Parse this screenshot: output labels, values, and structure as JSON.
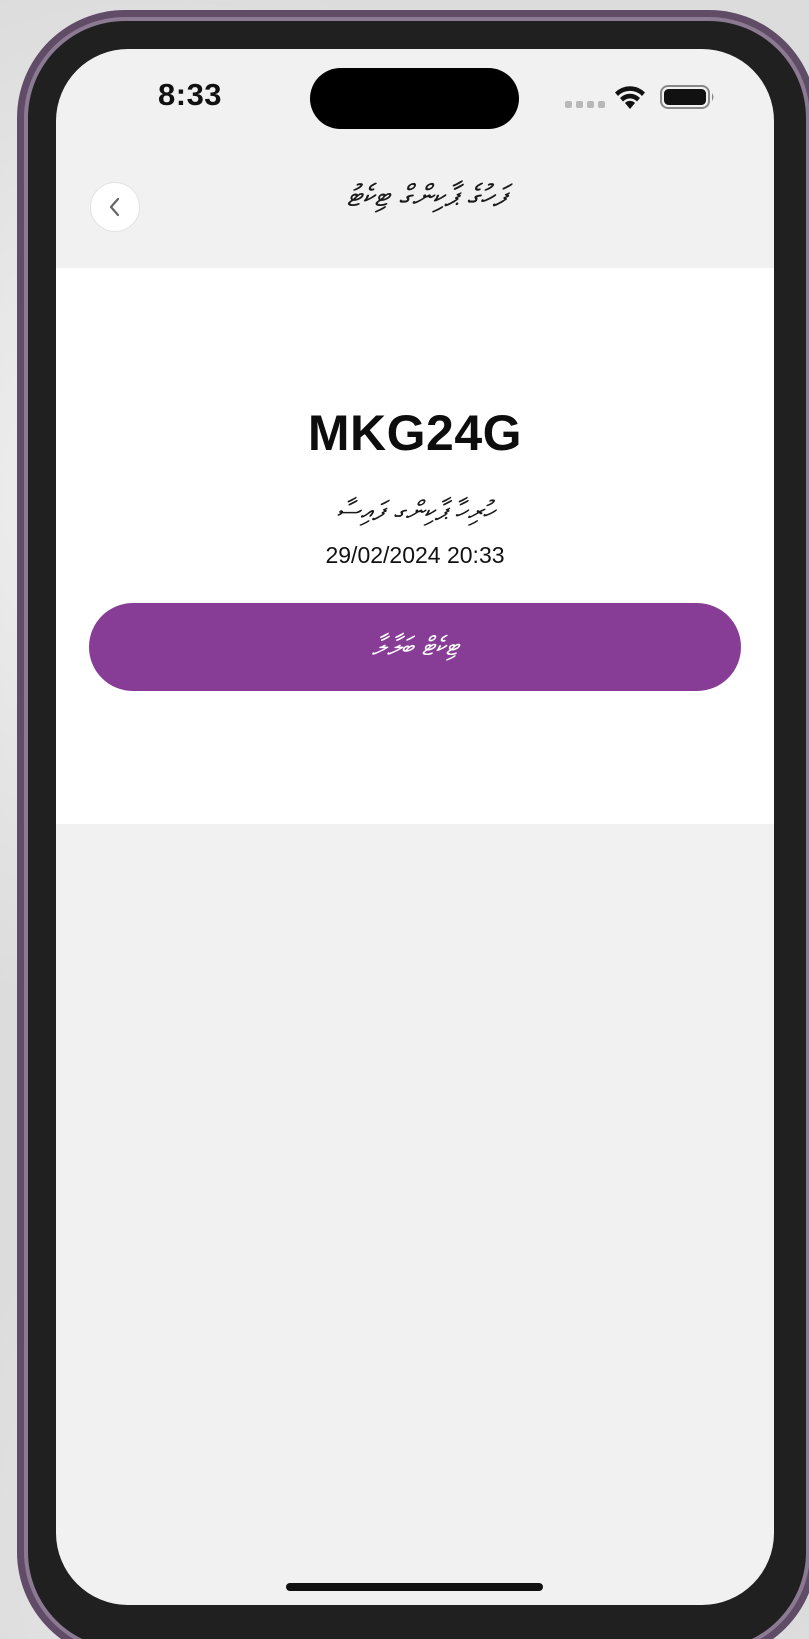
{
  "colors": {
    "accent": "#873d96",
    "screen_background": "#f1f1f1",
    "card_background": "#ffffff",
    "frame": "#614c68"
  },
  "status_bar": {
    "time": "8:33",
    "icons": [
      "signal-icon",
      "wifi-icon",
      "battery-icon"
    ]
  },
  "header": {
    "back_icon": "chevron-left-icon",
    "title": "ފަހުގެ ޕާކިންގް ޓިކެޓު"
  },
  "ticket": {
    "plate_number": "MKG24G",
    "status": "ހުރިހާ ޕާކިންގ ފައިސާ",
    "datetime": "29/02/2024 20:33",
    "pay_button_label": "ޓިކެޓް ބަލާލާ"
  }
}
